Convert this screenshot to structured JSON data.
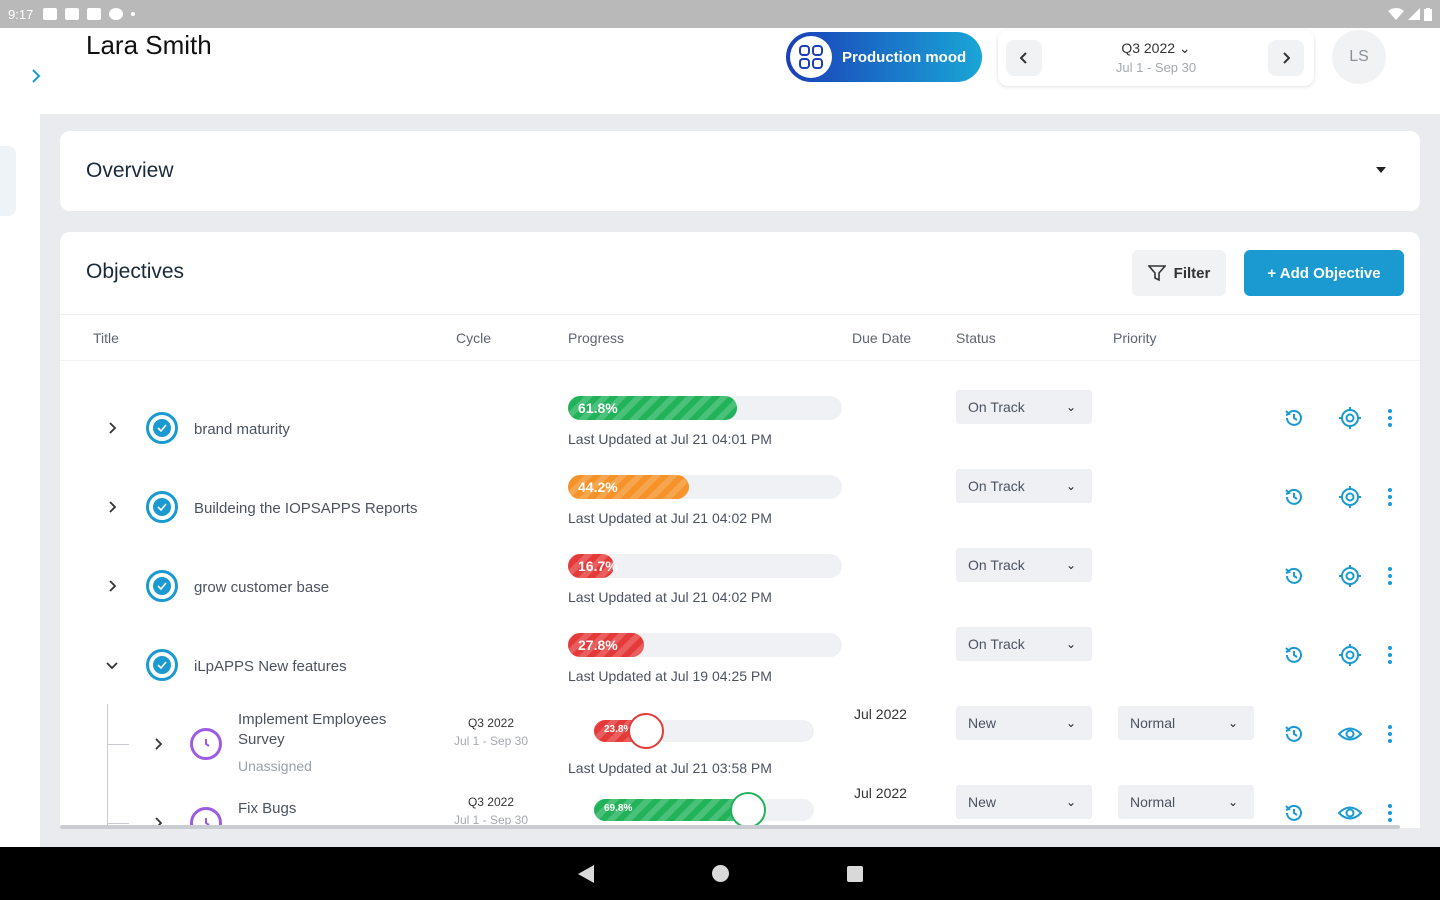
{
  "statusbar": {
    "time": "9:17"
  },
  "header": {
    "username": "Lara Smith",
    "production_mode_label": "Production mood",
    "cycle_name": "Q3 2022 ⌄",
    "cycle_range": "Jul 1 - Sep 30",
    "avatar_initials": "LS"
  },
  "overview": {
    "title": "Overview"
  },
  "objectives": {
    "title": "Objectives",
    "filter_label": "Filter",
    "add_label": "+ Add Objective",
    "columns": [
      "Title",
      "Cycle",
      "Progress",
      "Due Date",
      "Status",
      "Priority"
    ],
    "rows": [
      {
        "title": "brand maturity",
        "progress_label": "61.8%",
        "progress": 0.618,
        "color": "#22b35a",
        "updated": "Last Updated at Jul 21 04:01 PM",
        "status": "On Track"
      },
      {
        "title": "Buildeing the IOPSAPPS Reports",
        "progress_label": "44.2%",
        "progress": 0.442,
        "color": "#f5922a",
        "updated": "Last Updated at Jul 21 04:02 PM",
        "status": "On Track"
      },
      {
        "title": "grow customer base",
        "progress_label": "16.7%",
        "progress": 0.167,
        "color": "#e53a3a",
        "updated": "Last Updated at Jul 21 04:02 PM",
        "status": "On Track"
      },
      {
        "title": "iLpAPPS New features",
        "progress_label": "27.8%",
        "progress": 0.278,
        "color": "#e53a3a",
        "updated": "Last Updated at Jul 19 04:25 PM",
        "status": "On Track"
      }
    ],
    "key_results": [
      {
        "title": "Implement Employees Survey",
        "owner": "Unassigned",
        "cycle_name": "Q3 2022",
        "cycle_range": "Jul 1 - Sep 30",
        "progress_label": "23.8%",
        "progress": 0.238,
        "color": "#e53a3a",
        "updated": "Last Updated at Jul 21 03:58 PM",
        "due": "Jul 2022",
        "status": "New",
        "priority": "Normal"
      },
      {
        "title": "Fix Bugs",
        "owner": "",
        "cycle_name": "Q3 2022",
        "cycle_range": "Jul 1 - Sep 30",
        "progress_label": "69.8%",
        "progress": 0.698,
        "color": "#22b35a",
        "updated": "",
        "due": "Jul 2022",
        "status": "New",
        "priority": "Normal"
      }
    ]
  },
  "colors": {
    "accent": "#1a9ad1",
    "on_track_green": "#22b35a",
    "warning_orange": "#f5922a",
    "danger_red": "#e53a3a",
    "kr_purple": "#9b5de5"
  }
}
